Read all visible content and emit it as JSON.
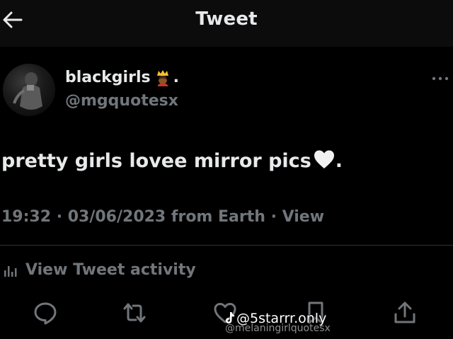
{
  "header": {
    "title": "Tweet",
    "back_icon": "arrow-left-icon"
  },
  "author": {
    "display_name": "blackgirls",
    "name_emoji": "crown-woman-emoji",
    "name_suffix": ".",
    "handle": "@mgquotesx",
    "avatar": "profile-photo-dark"
  },
  "tweet": {
    "text": "pretty girls lovee mirror pics",
    "emoji": "white-heart-emoji",
    "text_suffix": ".",
    "meta": "19:32 · 03/06/2023 from Earth · View"
  },
  "activity": {
    "label": "View Tweet activity",
    "icon": "bar-chart-icon"
  },
  "actions": [
    {
      "name": "reply",
      "icon": "reply-icon"
    },
    {
      "name": "retweet",
      "icon": "retweet-icon"
    },
    {
      "name": "like",
      "icon": "heart-outline-icon"
    },
    {
      "name": "bookmark",
      "icon": "bookmark-icon"
    },
    {
      "name": "share",
      "icon": "share-icon"
    }
  ],
  "watermark": {
    "main": "@5starrr.only",
    "sub": "@melaningirlquotesx",
    "icon": "tiktok-icon"
  },
  "colors": {
    "background": "#000000",
    "header_background": "#0c0c0c",
    "primary_text": "#e7e9ea",
    "secondary_text": "#71767b",
    "divider": "#2f3336"
  }
}
